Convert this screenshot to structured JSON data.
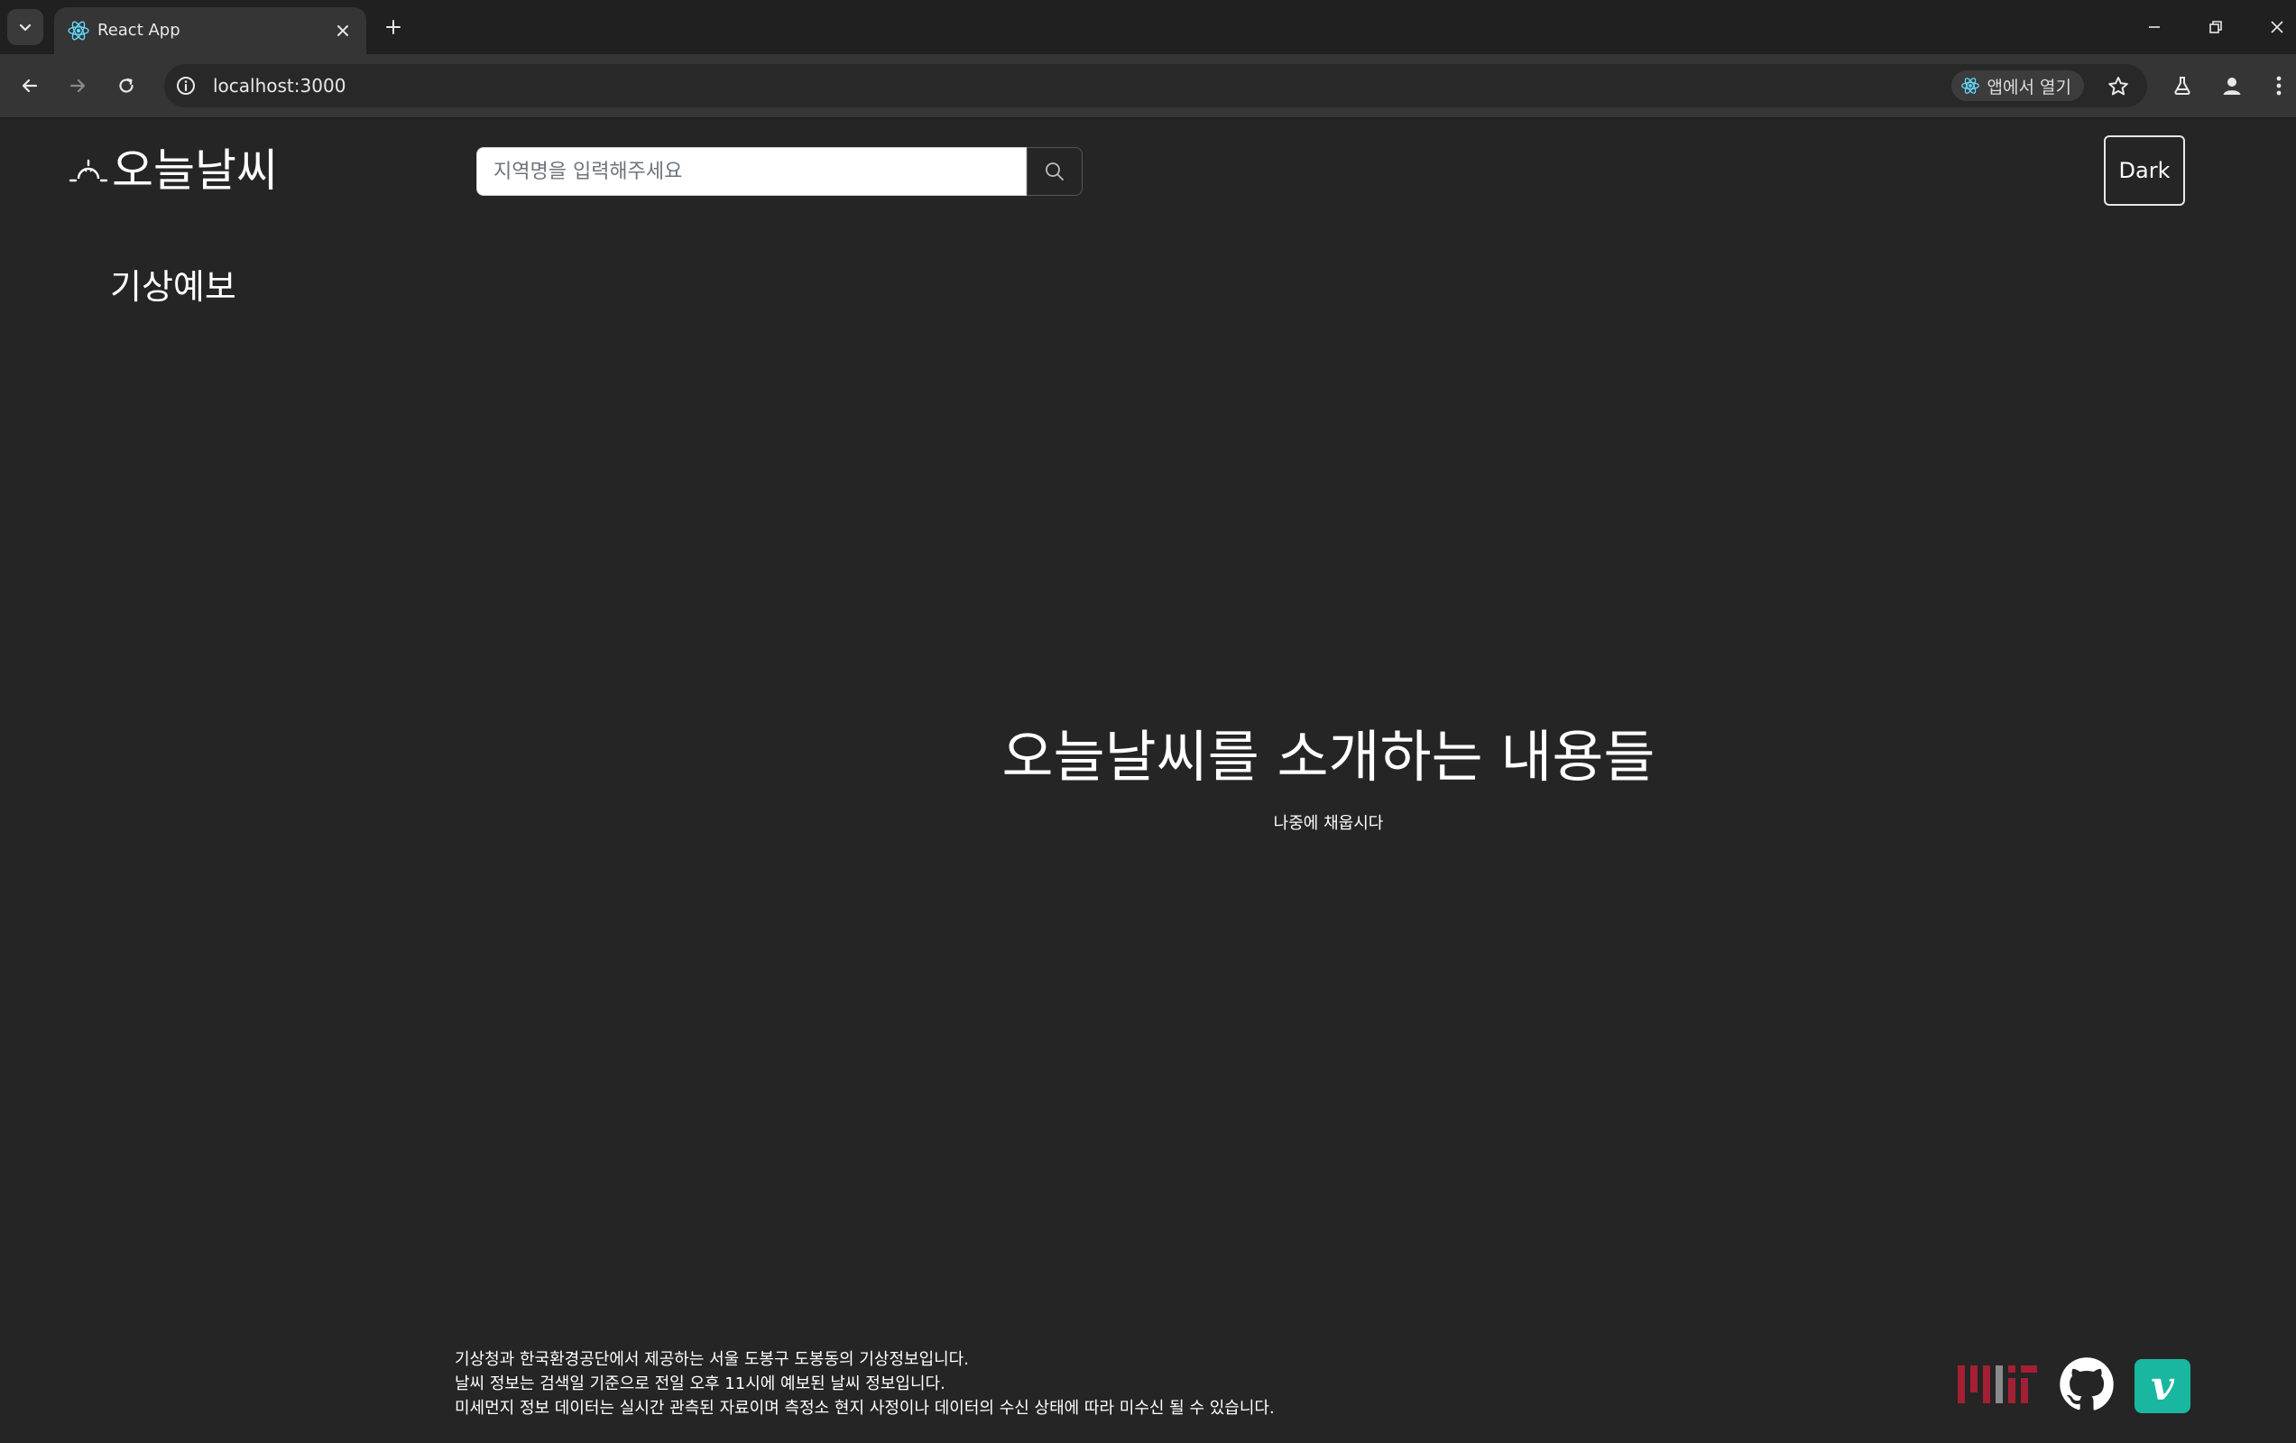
{
  "browser": {
    "tab": {
      "title": "React App"
    },
    "address_bar": {
      "url": "localhost:3000"
    },
    "open_in_app_label": "앱에서 열기"
  },
  "header": {
    "logo_text": "오늘날씨",
    "search": {
      "placeholder": "지역명을 입력해주세요",
      "value": ""
    },
    "theme_button_label": "Dark"
  },
  "sidebar": {
    "section_title": "기상예보"
  },
  "intro": {
    "title": "오늘날씨를 소개하는 내용들",
    "subtitle": "나중에 채웁시다"
  },
  "footer": {
    "notes": [
      "기상청과 한국환경공단에서 제공하는 서울 도봉구 도봉동의 기상정보입니다.",
      "날씨 정보는 검색일 기준으로 전일 오후 11시에 예보된 날씨 정보입니다.",
      "미세먼지 정보 데이터는 실시간 관측된 자료이며 측정소 현지 사정이나 데이터의 수신 상태에 따라 미수신 될 수 있습니다."
    ],
    "links": [
      {
        "icon": "mit-logo-icon"
      },
      {
        "icon": "github-icon"
      },
      {
        "icon": "vimeo-icon",
        "glyph": "v"
      }
    ]
  },
  "colors": {
    "page_background": "#252525",
    "chrome_tabstrip": "#202020",
    "chrome_toolbar": "#353535",
    "text": "#ffffff",
    "vimeo": "#1ab7a0",
    "mit_red": "#a31f34"
  }
}
